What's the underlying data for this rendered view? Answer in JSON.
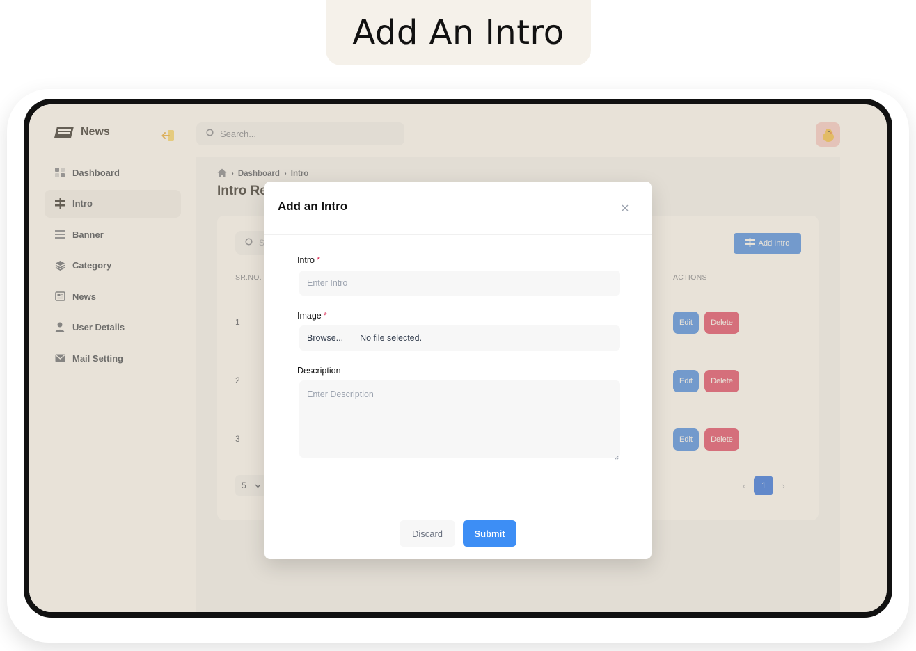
{
  "banner": {
    "title": "Add An Intro"
  },
  "sidebar": {
    "brand": "News",
    "items": [
      {
        "label": "Dashboard",
        "icon": "dashboard-icon"
      },
      {
        "label": "Intro",
        "icon": "signpost-icon",
        "active": true
      },
      {
        "label": "Banner",
        "icon": "menu-lines-icon"
      },
      {
        "label": "Category",
        "icon": "layers-icon"
      },
      {
        "label": "News",
        "icon": "newspaper-icon"
      },
      {
        "label": "User Details",
        "icon": "user-icon"
      },
      {
        "label": "Mail Setting",
        "icon": "mail-icon"
      }
    ]
  },
  "header": {
    "search_placeholder": "Search..."
  },
  "breadcrumb": {
    "items": [
      "Dashboard",
      "Intro"
    ]
  },
  "page": {
    "title": "Intro Re"
  },
  "table": {
    "search_placeholder": "S",
    "add_button": "Add Intro",
    "headers": {
      "sr_no": "SR.NO.",
      "actions": "ACTIONS"
    },
    "rows": [
      {
        "no": "1",
        "edit": "Edit",
        "delete": "Delete"
      },
      {
        "no": "2",
        "edit": "Edit",
        "delete": "Delete"
      },
      {
        "no": "3",
        "edit": "Edit",
        "delete": "Delete"
      }
    ],
    "page_size": "5",
    "current_page": "1"
  },
  "modal": {
    "title": "Add an Intro",
    "intro_label": "Intro",
    "intro_placeholder": "Enter Intro",
    "image_label": "Image",
    "browse_label": "Browse...",
    "file_status": "No file selected.",
    "description_label": "Description",
    "description_placeholder": "Enter Description",
    "required_mark": "*",
    "discard_label": "Discard",
    "submit_label": "Submit"
  },
  "colors": {
    "primary": "#2b7de9",
    "danger": "#dc2f57",
    "submit": "#3d8ef5",
    "overlay": "#ccbea8"
  }
}
